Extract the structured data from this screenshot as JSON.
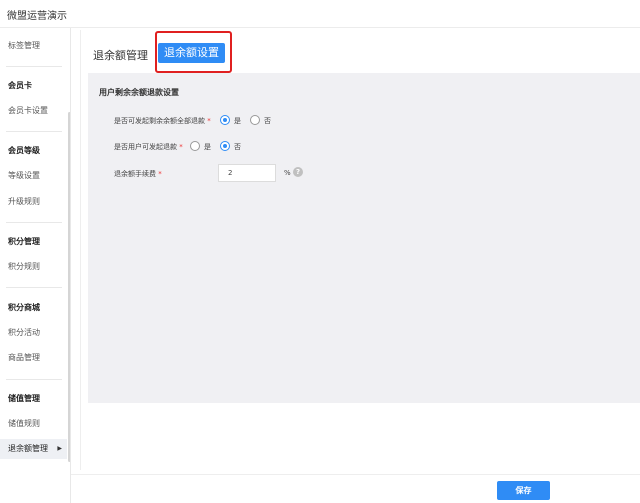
{
  "app": {
    "title": "微盟运营演示"
  },
  "sidebar": {
    "items": [
      {
        "type": "item",
        "label": "标签管理"
      },
      {
        "type": "group",
        "label": "会员卡"
      },
      {
        "type": "item",
        "label": "会员卡设置"
      },
      {
        "type": "group",
        "label": "会员等级"
      },
      {
        "type": "item",
        "label": "等级设置"
      },
      {
        "type": "item",
        "label": "升级规则"
      },
      {
        "type": "group",
        "label": "积分管理"
      },
      {
        "type": "item",
        "label": "积分规则"
      },
      {
        "type": "group",
        "label": "积分商城"
      },
      {
        "type": "item",
        "label": "积分活动"
      },
      {
        "type": "item",
        "label": "商品管理"
      },
      {
        "type": "group",
        "label": "储值管理"
      },
      {
        "type": "item",
        "label": "储值规则"
      },
      {
        "type": "item",
        "label": "退余额管理",
        "active": true
      }
    ]
  },
  "tabs": [
    {
      "label": "退余额管理",
      "active": false
    },
    {
      "label": "退余额设置",
      "active": true
    }
  ],
  "panel": {
    "title": "用户剩余余额退款设置",
    "fields": [
      {
        "label": "是否可发起剩余余额全部退款",
        "required_mark": "*",
        "options": [
          "是",
          "否"
        ],
        "selected": "是"
      },
      {
        "label": "是否用户可发起退款",
        "required_mark": "*",
        "options": [
          "是",
          "否"
        ],
        "selected": "否"
      },
      {
        "label": "退余额手续费",
        "required_mark": "*",
        "value": "2",
        "unit": "%",
        "help": "?"
      }
    ]
  },
  "footer": {
    "save_label": "保存"
  },
  "colors": {
    "primary": "#2f8cf5",
    "highlight": "#e02020",
    "panel_bg": "#f0f0f3"
  }
}
